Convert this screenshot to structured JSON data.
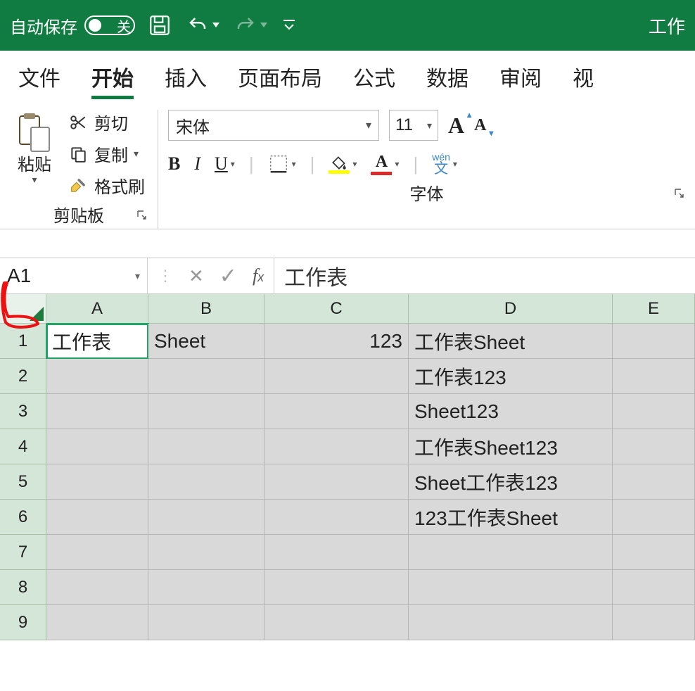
{
  "titlebar": {
    "autosave_label": "自动保存",
    "autosave_state": "关",
    "title_fragment": "工作"
  },
  "tabs": {
    "file": "文件",
    "home": "开始",
    "insert": "插入",
    "layout": "页面布局",
    "formula": "公式",
    "data": "数据",
    "review": "审阅",
    "view_fragment": "视"
  },
  "ribbon": {
    "clipboard": {
      "paste": "粘贴",
      "cut": "剪切",
      "copy": "复制",
      "format_painter": "格式刷",
      "group_label": "剪贴板"
    },
    "font": {
      "font_name": "宋体",
      "font_size": "11",
      "wen_pinyin": "wén",
      "wen_char": "文",
      "group_label": "字体"
    }
  },
  "formula_bar": {
    "cell_ref": "A1",
    "value": "工作表"
  },
  "sheet": {
    "columns": [
      "A",
      "B",
      "C",
      "D",
      "E"
    ],
    "row_numbers": [
      "1",
      "2",
      "3",
      "4",
      "5",
      "6",
      "7",
      "8",
      "9"
    ],
    "cells": {
      "A1": "工作表",
      "B1": "Sheet",
      "C1": "123",
      "D1": "工作表Sheet",
      "D2": "工作表123",
      "D3": "Sheet123",
      "D4": "工作表Sheet123",
      "D5": "Sheet工作表123",
      "D6": "123工作表Sheet"
    }
  }
}
